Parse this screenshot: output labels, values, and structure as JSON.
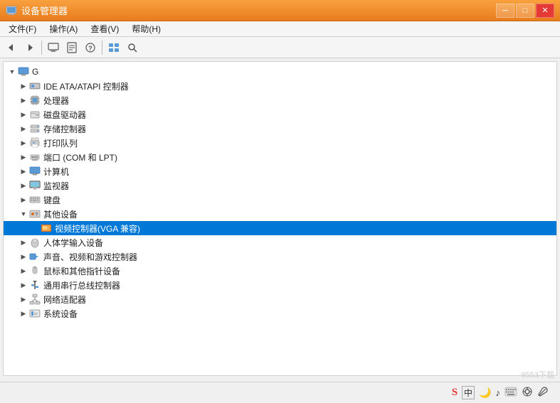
{
  "window": {
    "title": "设备管理器",
    "icon": "💻"
  },
  "title_controls": {
    "minimize": "─",
    "maximize": "□",
    "close": "✕"
  },
  "menu": {
    "items": [
      {
        "label": "文件(F)"
      },
      {
        "label": "操作(A)"
      },
      {
        "label": "查看(V)"
      },
      {
        "label": "帮助(H)"
      }
    ]
  },
  "toolbar": {
    "buttons": [
      {
        "name": "back",
        "icon": "◀"
      },
      {
        "name": "forward",
        "icon": "▶"
      },
      {
        "name": "computer",
        "icon": "🖥"
      },
      {
        "name": "properties",
        "icon": "📋"
      },
      {
        "name": "help",
        "icon": "❓"
      },
      {
        "name": "show-devices",
        "icon": "🖨"
      },
      {
        "name": "scan",
        "icon": "🔍"
      }
    ]
  },
  "tree": {
    "root": "G",
    "items": [
      {
        "id": "root",
        "label": "G",
        "level": 0,
        "expanded": true,
        "has_children": true,
        "icon": "computer"
      },
      {
        "id": "ide",
        "label": "IDE ATA/ATAPI 控制器",
        "level": 1,
        "expanded": false,
        "has_children": true,
        "icon": "disk"
      },
      {
        "id": "cpu",
        "label": "处理器",
        "level": 1,
        "expanded": false,
        "has_children": true,
        "icon": "cpu"
      },
      {
        "id": "disk",
        "label": "磁盘驱动器",
        "level": 1,
        "expanded": false,
        "has_children": true,
        "icon": "disk2"
      },
      {
        "id": "storage",
        "label": "存储控制器",
        "level": 1,
        "expanded": false,
        "has_children": true,
        "icon": "storage"
      },
      {
        "id": "print",
        "label": "打印队列",
        "level": 1,
        "expanded": false,
        "has_children": true,
        "icon": "print"
      },
      {
        "id": "port",
        "label": "端口 (COM 和 LPT)",
        "level": 1,
        "expanded": false,
        "has_children": true,
        "icon": "port"
      },
      {
        "id": "computer",
        "label": "计算机",
        "level": 1,
        "expanded": false,
        "has_children": true,
        "icon": "comp"
      },
      {
        "id": "monitor",
        "label": "监视器",
        "level": 1,
        "expanded": false,
        "has_children": true,
        "icon": "monitor"
      },
      {
        "id": "keyboard",
        "label": "键盘",
        "level": 1,
        "expanded": false,
        "has_children": true,
        "icon": "keyboard"
      },
      {
        "id": "other",
        "label": "其他设备",
        "level": 1,
        "expanded": true,
        "has_children": true,
        "icon": "other"
      },
      {
        "id": "vga",
        "label": "视频控制器(VGA 兼容)",
        "level": 2,
        "expanded": false,
        "has_children": false,
        "icon": "vga",
        "selected": true
      },
      {
        "id": "hid",
        "label": "人体学输入设备",
        "level": 1,
        "expanded": false,
        "has_children": true,
        "icon": "hid"
      },
      {
        "id": "audio",
        "label": "声音、视频和游戏控制器",
        "level": 1,
        "expanded": false,
        "has_children": true,
        "icon": "audio"
      },
      {
        "id": "mouse",
        "label": "鼠标和其他指针设备",
        "level": 1,
        "expanded": false,
        "has_children": true,
        "icon": "mouse"
      },
      {
        "id": "bus",
        "label": "通用串行总线控制器",
        "level": 1,
        "expanded": false,
        "has_children": true,
        "icon": "usb"
      },
      {
        "id": "network",
        "label": "网络适配器",
        "level": 1,
        "expanded": false,
        "has_children": true,
        "icon": "network"
      },
      {
        "id": "system",
        "label": "系统设备",
        "level": 1,
        "expanded": false,
        "has_children": true,
        "icon": "system"
      }
    ]
  },
  "statusbar": {
    "icons": [
      "S",
      "中",
      "🌙",
      "♪",
      "⌨",
      "☰",
      "⚙",
      "🔧"
    ]
  },
  "watermark": "9553下载"
}
